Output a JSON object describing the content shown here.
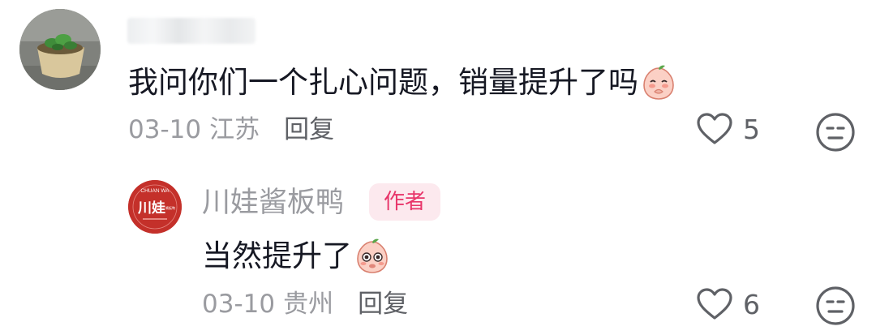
{
  "comment": {
    "text": "我问你们一个扎心问题，销量提升了吗",
    "date": "03-10",
    "location": "江苏",
    "reply_label": "回复",
    "like_count": "5",
    "avatar_icon": "plant-pot-avatar",
    "emoji_icon": "peach-shy-emoji"
  },
  "reply": {
    "username": "川娃酱板鸭",
    "badge": "作者",
    "avatar_logo": {
      "top_text": "CHUAN WA",
      "main_text": "川娃",
      "side_text": "酱板鸭"
    },
    "text": "当然提升了",
    "date": "03-10",
    "location": "贵州",
    "reply_label": "回复",
    "like_count": "6",
    "emoji_icon": "peach-staring-emoji"
  },
  "colors": {
    "text_primary": "#161823",
    "text_secondary": "#9a9ba0",
    "badge_bg": "#fce9ee",
    "badge_text": "#e8356a",
    "brand_red": "#c4302a"
  }
}
